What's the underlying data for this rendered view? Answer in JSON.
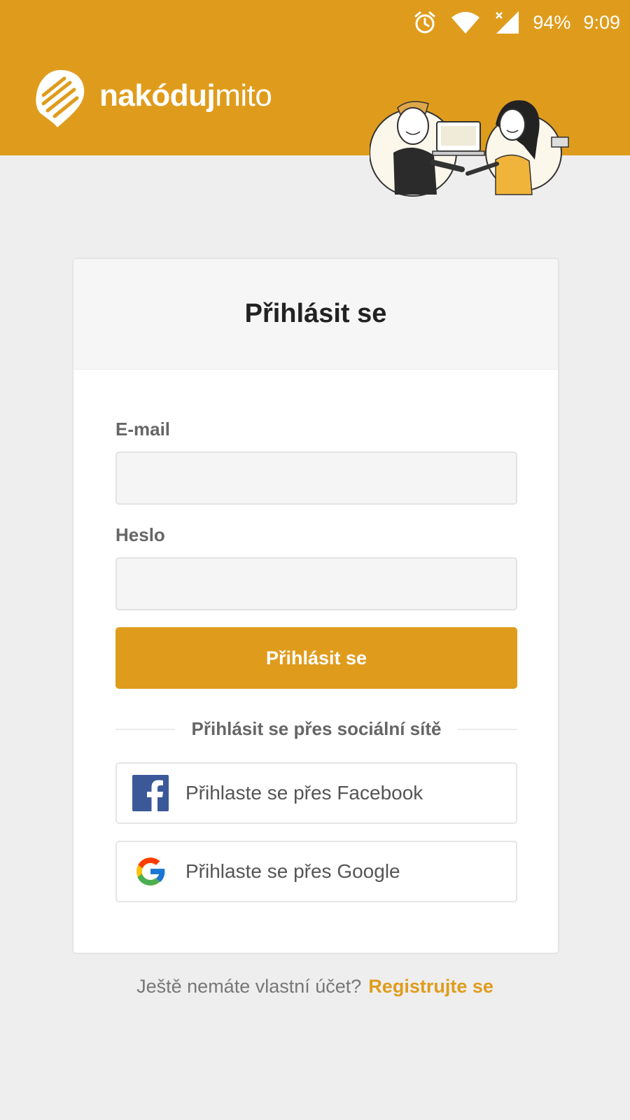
{
  "status_bar": {
    "battery": "94%",
    "time": "9:09",
    "icons": [
      "alarm-icon",
      "wifi-icon",
      "cell-signal-icon"
    ]
  },
  "brand": {
    "name_bold": "nakóduj",
    "name_light": "mito",
    "color": "#df9c1c"
  },
  "login": {
    "title": "Přihlásit se",
    "email_label": "E-mail",
    "email_value": "",
    "password_label": "Heslo",
    "password_value": "",
    "submit_label": "Přihlásit se",
    "social_divider": "Přihlásit se přes sociální sítě",
    "facebook_label": "Přihlaste se přes Facebook",
    "google_label": "Přihlaste se přes Google"
  },
  "footer": {
    "question": "Ještě nemáte vlastní účet?",
    "register_link": "Registrujte se"
  }
}
